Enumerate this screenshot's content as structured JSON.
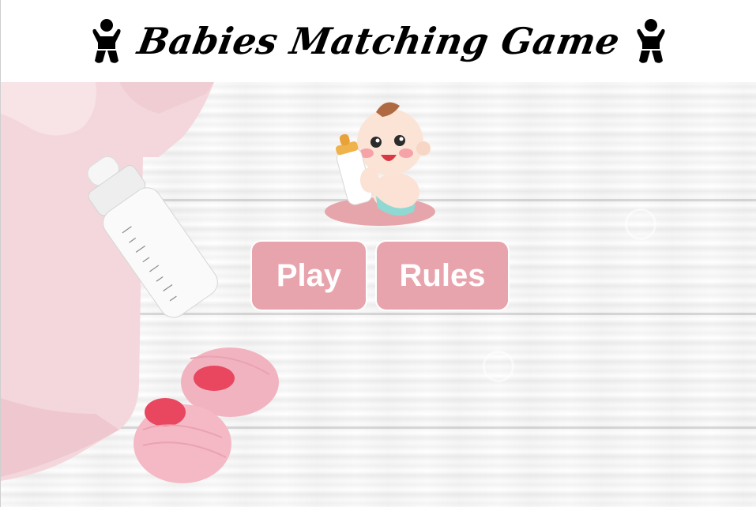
{
  "header": {
    "title": "Babies Matching Game",
    "left_icon": "baby-icon",
    "right_icon": "baby-icon"
  },
  "menu": {
    "play_label": "Play",
    "rules_label": "Rules"
  },
  "colors": {
    "button_bg": "#e8a4ad",
    "button_text": "#ffffff",
    "title_text": "#000000"
  }
}
